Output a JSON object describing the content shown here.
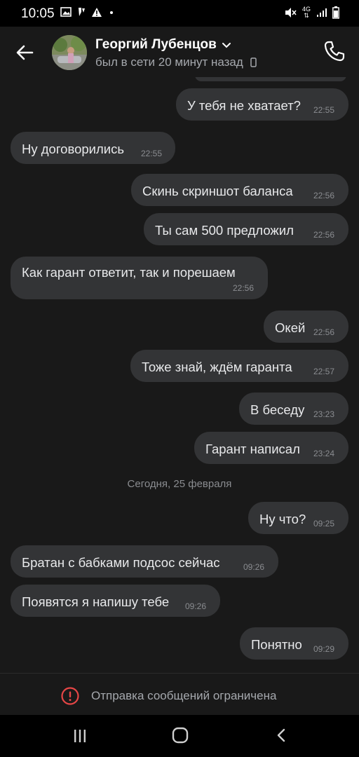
{
  "status_bar": {
    "time": "10:05",
    "icons_left": [
      "image-icon",
      "pin-icon",
      "alert-icon",
      "dot-icon"
    ],
    "network_label": "4G",
    "icons_right": [
      "mute-icon",
      "network-4g-icon",
      "signal-icon",
      "battery-icon"
    ]
  },
  "header": {
    "name": "Георгий Лубенцов",
    "status": "был в сети 20 минут назад",
    "icons": [
      "back-arrow-icon",
      "chevron-down-icon",
      "phone-device-icon",
      "call-icon"
    ]
  },
  "messages": [
    {
      "side": "out",
      "text": "У тебя не хватает?",
      "time": "22:55"
    },
    {
      "side": "in",
      "text": "Ну договорились",
      "time": "22:55"
    },
    {
      "side": "out",
      "text": "Скинь скриншот баланса",
      "time": "22:56"
    },
    {
      "side": "out",
      "text": "Ты сам 500 предложил",
      "time": "22:56"
    },
    {
      "side": "in",
      "text": "Как гарант ответит, так и порешаем",
      "time": "22:56"
    },
    {
      "side": "out",
      "text": "Окей",
      "time": "22:56"
    },
    {
      "side": "out",
      "text": "Тоже знай, ждём гаранта",
      "time": "22:57"
    },
    {
      "side": "out",
      "text": "В беседу",
      "time": "23:23"
    },
    {
      "side": "out",
      "text": "Гарант написал",
      "time": "23:24"
    },
    {
      "side": "out",
      "text": "Ну что?",
      "time": "09:25"
    },
    {
      "side": "in",
      "text": "Братан с бабками подсос сейчас",
      "time": "09:26"
    },
    {
      "side": "in",
      "text": "Появятся я напишу тебе",
      "time": "09:26"
    },
    {
      "side": "out",
      "text": "Понятно",
      "time": "09:29"
    }
  ],
  "date_separator": "Сегодня, 25 февраля",
  "composer": {
    "restriction_text": "Отправка сообщений ограничена",
    "icon": "warning-circle-icon",
    "accent": "#e64646"
  },
  "nav_bar": {
    "icons": [
      "recent-apps-icon",
      "home-icon",
      "back-icon"
    ]
  }
}
